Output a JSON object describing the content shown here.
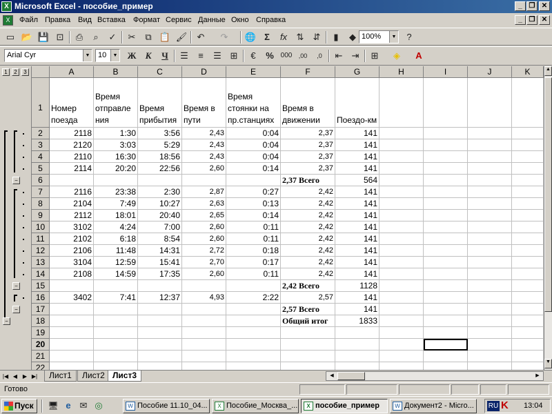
{
  "window": {
    "title": "Microsoft Excel - пособие_пример"
  },
  "menu": [
    "Файл",
    "Правка",
    "Вид",
    "Вставка",
    "Формат",
    "Сервис",
    "Данные",
    "Окно",
    "Справка"
  ],
  "toolbar": {
    "zoom": "100%"
  },
  "format": {
    "font": "Arial Cyr",
    "size": "10",
    "bold": "Ж",
    "italic": "К",
    "underline": "Ч",
    "currency": "%",
    "thousands": "000"
  },
  "outline_levels": [
    "1",
    "2",
    "3"
  ],
  "columns": [
    "A",
    "B",
    "C",
    "D",
    "E",
    "F",
    "G",
    "H",
    "I",
    "J",
    "K"
  ],
  "header": {
    "row": "1",
    "cells": [
      "Номер поезда",
      "Время отправле ния",
      "Время прибытия",
      "Время в пути",
      "Время стоянки на пр.станциях",
      "Время в движении",
      "Поездо-км"
    ]
  },
  "rows": [
    {
      "n": "2",
      "cells": [
        "2118",
        "1:30",
        "3:56",
        "2,43",
        "0:04",
        "2,37",
        "141"
      ]
    },
    {
      "n": "3",
      "cells": [
        "2120",
        "3:03",
        "5:29",
        "2,43",
        "0:04",
        "2,37",
        "141"
      ]
    },
    {
      "n": "4",
      "cells": [
        "2110",
        "16:30",
        "18:56",
        "2,43",
        "0:04",
        "2,37",
        "141"
      ]
    },
    {
      "n": "5",
      "cells": [
        "2114",
        "20:20",
        "22:56",
        "2,60",
        "0:14",
        "2,37",
        "141"
      ]
    },
    {
      "n": "6",
      "total": "2,37 Всего",
      "g": "564"
    },
    {
      "n": "7",
      "cells": [
        "2116",
        "23:38",
        "2:30",
        "2,87",
        "0:27",
        "2,42",
        "141"
      ]
    },
    {
      "n": "8",
      "cells": [
        "2104",
        "7:49",
        "10:27",
        "2,63",
        "0:13",
        "2,42",
        "141"
      ]
    },
    {
      "n": "9",
      "cells": [
        "2112",
        "18:01",
        "20:40",
        "2,65",
        "0:14",
        "2,42",
        "141"
      ]
    },
    {
      "n": "10",
      "cells": [
        "3102",
        "4:24",
        "7:00",
        "2,60",
        "0:11",
        "2,42",
        "141"
      ]
    },
    {
      "n": "11",
      "cells": [
        "2102",
        "6:18",
        "8:54",
        "2,60",
        "0:11",
        "2,42",
        "141"
      ]
    },
    {
      "n": "12",
      "cells": [
        "2106",
        "11:48",
        "14:31",
        "2,72",
        "0:18",
        "2,42",
        "141"
      ]
    },
    {
      "n": "13",
      "cells": [
        "3104",
        "12:59",
        "15:41",
        "2,70",
        "0:17",
        "2,42",
        "141"
      ]
    },
    {
      "n": "14",
      "cells": [
        "2108",
        "14:59",
        "17:35",
        "2,60",
        "0:11",
        "2,42",
        "141"
      ]
    },
    {
      "n": "15",
      "total": "2,42 Всего",
      "g": "1128"
    },
    {
      "n": "16",
      "cells": [
        "3402",
        "7:41",
        "12:37",
        "4,93",
        "2:22",
        "2,57",
        "141"
      ]
    },
    {
      "n": "17",
      "total": "2,57 Всего",
      "g": "141"
    },
    {
      "n": "18",
      "total": "Общий итог",
      "g": "1833"
    },
    {
      "n": "19"
    },
    {
      "n": "20"
    },
    {
      "n": "21"
    },
    {
      "n": "22"
    }
  ],
  "sheets": [
    "Лист1",
    "Лист2",
    "Лист3"
  ],
  "status": {
    "text": "Готово"
  },
  "taskbar": {
    "start": "Пуск",
    "tasks": [
      "Пособие 11.10_04...",
      "Пособие_Москва_...",
      "пособие_пример",
      "Документ2 - Micro..."
    ],
    "lang": "RU",
    "clock": "13:04"
  }
}
